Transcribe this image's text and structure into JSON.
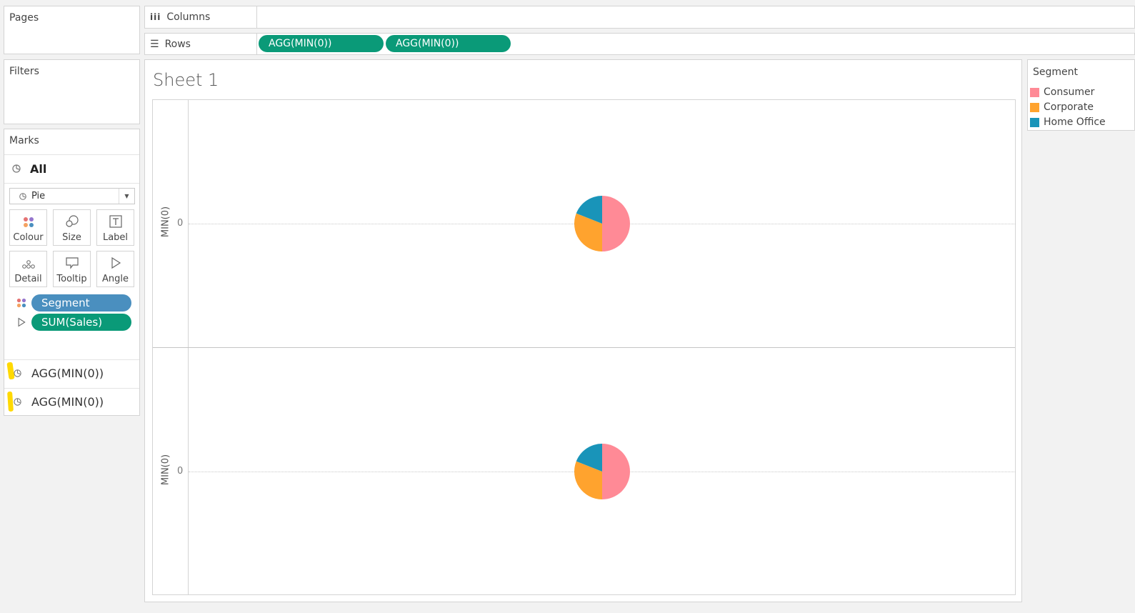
{
  "pages": {
    "title": "Pages"
  },
  "filters": {
    "title": "Filters"
  },
  "columns": {
    "label": "Columns"
  },
  "rows": {
    "label": "Rows",
    "pills": [
      "AGG(MIN(0))",
      "AGG(MIN(0))"
    ]
  },
  "marks": {
    "title": "Marks",
    "all_label": "All",
    "mark_type": "Pie",
    "buttons": [
      "Colour",
      "Size",
      "Label",
      "Detail",
      "Tooltip",
      "Angle"
    ],
    "fields": [
      {
        "label": "Segment",
        "role": "colour"
      },
      {
        "label": "SUM(Sales)",
        "role": "angle"
      }
    ],
    "layers": [
      "AGG(MIN(0))",
      "AGG(MIN(0))"
    ]
  },
  "sheet": {
    "title": "Sheet 1",
    "axis_title": "MIN(0)",
    "tick": "0"
  },
  "legend": {
    "title": "Segment",
    "items": [
      {
        "label": "Consumer",
        "color": "#ff8a96"
      },
      {
        "label": "Corporate",
        "color": "#ffa32e"
      },
      {
        "label": "Home Office",
        "color": "#1994b9"
      }
    ]
  },
  "chart_data": [
    {
      "type": "pie",
      "categories": [
        "Consumer",
        "Corporate",
        "Home Office"
      ],
      "values": [
        50,
        31,
        19
      ],
      "colors": [
        "#ff8a96",
        "#ffa32e",
        "#1994b9"
      ]
    },
    {
      "type": "pie",
      "categories": [
        "Consumer",
        "Corporate",
        "Home Office"
      ],
      "values": [
        50,
        31,
        19
      ],
      "colors": [
        "#ff8a96",
        "#ffa32e",
        "#1994b9"
      ]
    }
  ]
}
